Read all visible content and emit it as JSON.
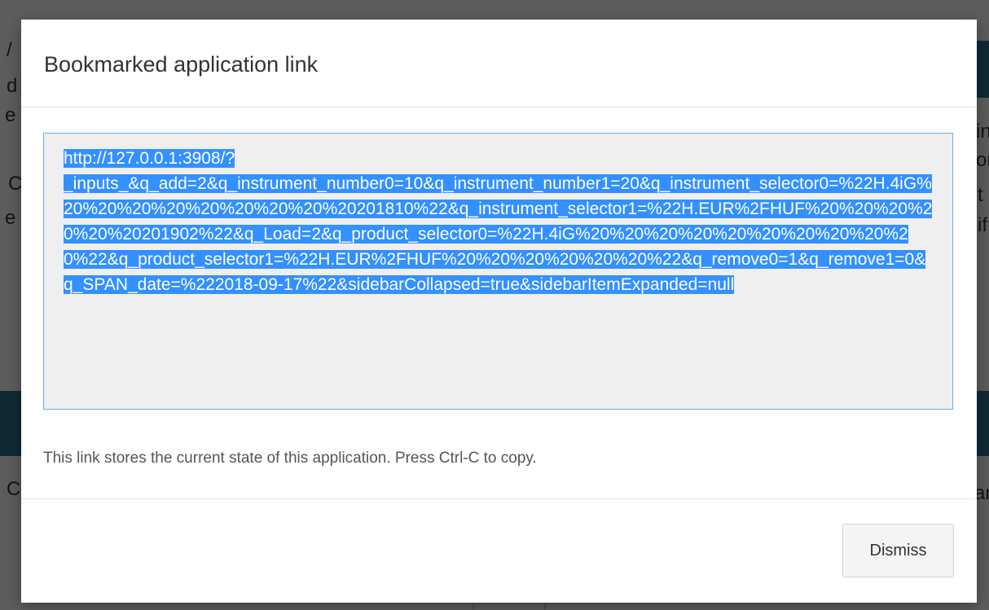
{
  "background": {
    "fragments": [
      "/",
      "d",
      "e",
      "C",
      "e",
      "C",
      "in",
      "or",
      "t",
      "if",
      "ar"
    ]
  },
  "modal": {
    "title": "Bookmarked application link",
    "link": "http://127.0.0.1:3908/?_inputs_&q_add=2&q_instrument_number0=10&q_instrument_number1=20&q_instrument_selector0=%22H.4iG%20%20%20%20%20%20%20%20%20201810%22&q_instrument_selector1=%22H.EUR%2FHUF%20%20%20%20%20%20201902%22&q_Load=2&q_product_selector0=%22H.4iG%20%20%20%20%20%20%20%20%20%20%22&q_product_selector1=%22H.EUR%2FHUF%20%20%20%20%20%20%22&q_remove0=1&q_remove1=0&q_SPAN_date=%222018-09-17%22&sidebarCollapsed=true&sidebarItemExpanded=null",
    "link_line1": "http://127.0.0.1:3908/?",
    "link_rest": "_inputs_&q_add=2&q_instrument_number0=10&q_instrument_number1=20&q_instrument_selector0=%22H.4iG%20%20%20%20%20%20%20%20%20201810%22&q_instrument_selector1=%22H.EUR%2FHUF%20%20%20%20%20%20201902%22&q_Load=2&q_product_selector0=%22H.4iG%20%20%20%20%20%20%20%20%20%20%22&q_product_selector1=%22H.EUR%2FHUF%20%20%20%20%20%20%22&q_remove0=1&q_remove1=0&q_SPAN_date=%222018-09-17%22&sidebarCollapsed=true&sidebarItemExpanded=null",
    "description": "This link stores the current state of this application. Press Ctrl-C to copy.",
    "dismiss_label": "Dismiss"
  },
  "colors": {
    "selection": "#3390ff",
    "focus_border": "#66afe9",
    "overlay": "#000000"
  }
}
